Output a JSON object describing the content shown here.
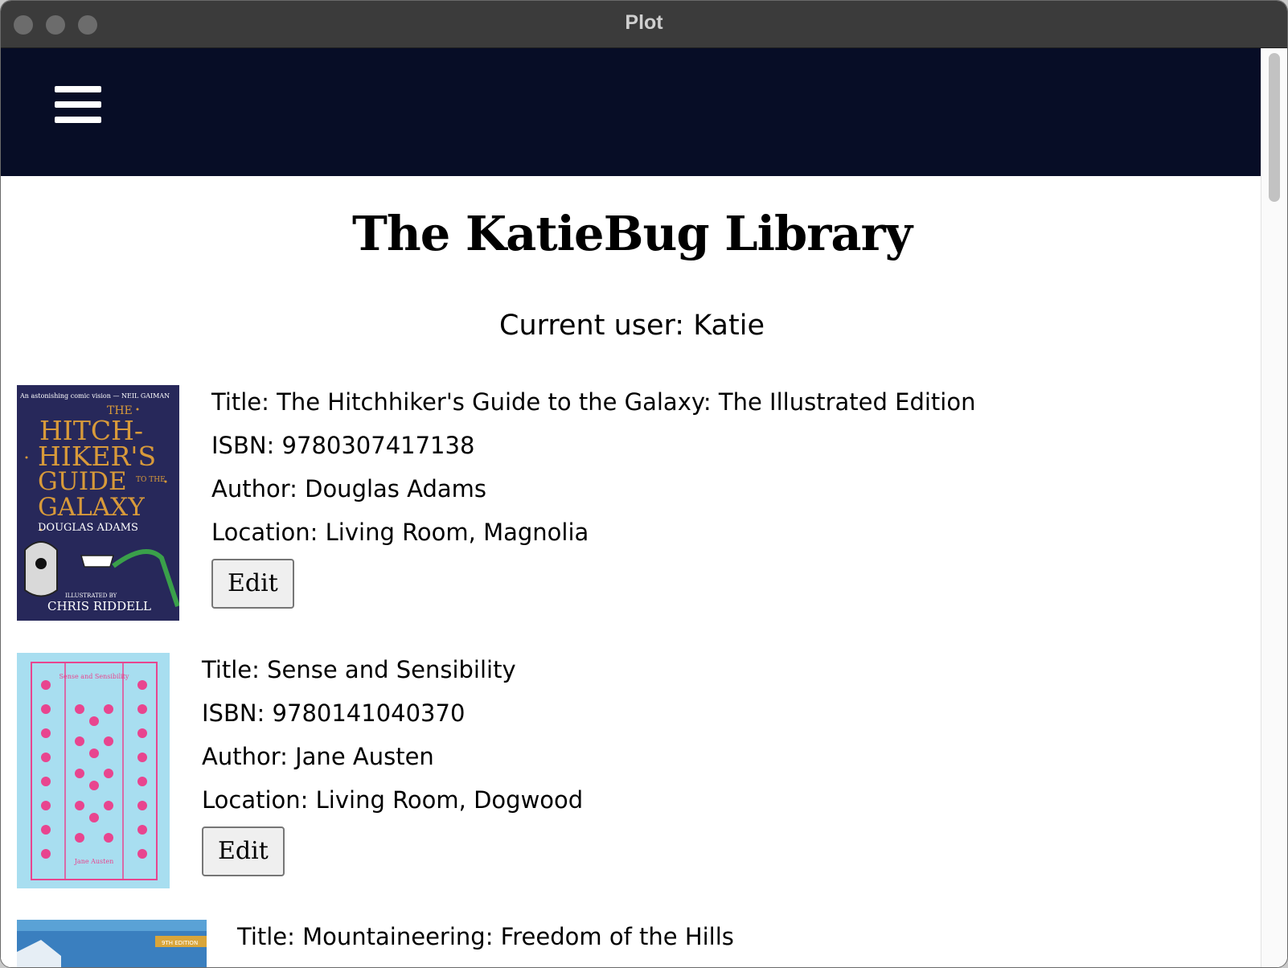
{
  "window": {
    "title": "Plot"
  },
  "header": {
    "menu_icon": "hamburger-menu-icon"
  },
  "page": {
    "title": "The KatieBug Library",
    "current_user": "Current user: Katie"
  },
  "books": [
    {
      "title": "Title: The Hitchhiker's Guide to the Galaxy: The Illustrated Edition",
      "isbn": "ISBN: 9780307417138",
      "author": "Author: Douglas Adams",
      "location": "Location: Living Room, Magnolia",
      "edit_label": "Edit",
      "cover": {
        "t1": "THE",
        "t2": "HITCH-",
        "t3": "HIKER'S",
        "t4": "GUIDE",
        "t5": "TO THE",
        "t6": "GALAXY",
        "author": "DOUGLAS ADAMS",
        "illus": "ILLUSTRATED BY",
        "illustrator": "CHRIS RIDDELL",
        "blurb": "An astonishing comic vision — NEIL GAIMAN"
      }
    },
    {
      "title": "Title: Sense and Sensibility",
      "isbn": "ISBN: 9780141040370",
      "author": "Author: Jane Austen",
      "location": "Location: Living Room, Dogwood",
      "edit_label": "Edit",
      "cover": {
        "top": "Sense and Sensibility",
        "bottom": "Jane Austen"
      }
    },
    {
      "title": "Title: Mountaineering: Freedom of the Hills",
      "cover": {
        "badge": "9TH EDITION"
      }
    }
  ],
  "colors": {
    "navbar": "#070d26",
    "hitchhiker_cover": "#27285a",
    "hitchhiker_lettering": "#d89a3a",
    "sense_cover": "#a8def0",
    "sense_pattern": "#e8458f"
  }
}
